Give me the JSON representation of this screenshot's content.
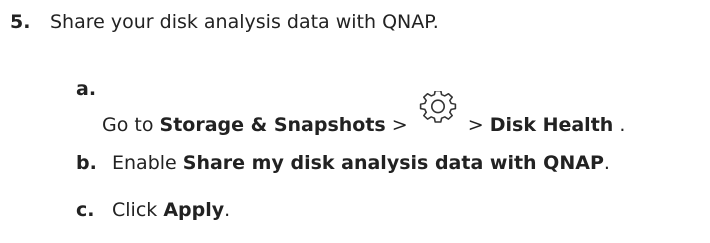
{
  "step": {
    "number": "5.",
    "text": "Share your disk analysis data with QNAP."
  },
  "substeps": {
    "a": {
      "label": "a.",
      "prefix": "Go to ",
      "bold1": "Storage & Snapshots",
      "sep1": " > ",
      "icon": "gear-icon",
      "sep2": " > ",
      "bold2": "Disk Health",
      "suffix": " ."
    },
    "b": {
      "label": "b.",
      "prefix": "Enable ",
      "bold": "Share my disk analysis data with QNAP",
      "suffix": "."
    },
    "c": {
      "label": "c.",
      "prefix": "Click ",
      "bold": "Apply",
      "suffix": "."
    }
  }
}
